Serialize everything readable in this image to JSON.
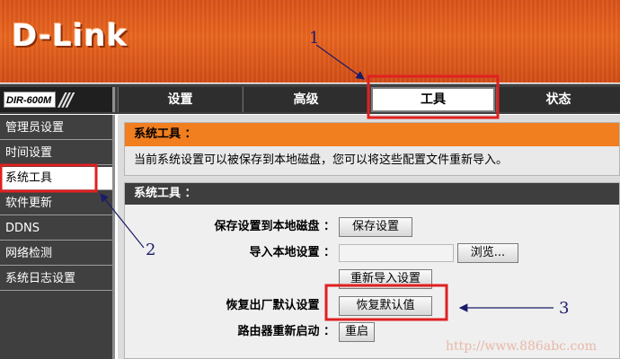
{
  "header": {
    "logo_text": "D-Link"
  },
  "nav": {
    "model": "DIR-600M",
    "tabs": [
      {
        "label": "设置"
      },
      {
        "label": "高级"
      },
      {
        "label": "工具"
      },
      {
        "label": "状态"
      }
    ]
  },
  "sidebar": {
    "items": [
      {
        "label": "管理员设置"
      },
      {
        "label": "时间设置"
      },
      {
        "label": "系统工具"
      },
      {
        "label": "软件更新"
      },
      {
        "label": "DDNS"
      },
      {
        "label": "网络检测"
      },
      {
        "label": "系统日志设置"
      }
    ]
  },
  "intro": {
    "title": "系统工具 ：",
    "description": "当前系统设置可以被保存到本地磁盘，您可以将这些配置文件重新导入。"
  },
  "tools": {
    "title": "系统工具 ：",
    "save_label": "保存设置到本地磁盘 ：",
    "save_button": "保存设置",
    "import_label": "导入本地设置 ：",
    "browse_button": "浏览...",
    "reimport_button": "重新导入设置",
    "restore_label": "恢复出厂默认设置 ：",
    "restore_button": "恢复默认值",
    "reboot_label": "路由器重新启动 ：",
    "reboot_button": "重启"
  },
  "annotations": {
    "n1": "1",
    "n2": "2",
    "n3": "3",
    "highlight_color": "#e02020",
    "arrow_color": "#1b1b6a"
  },
  "watermark": "http://www.886abc.com"
}
